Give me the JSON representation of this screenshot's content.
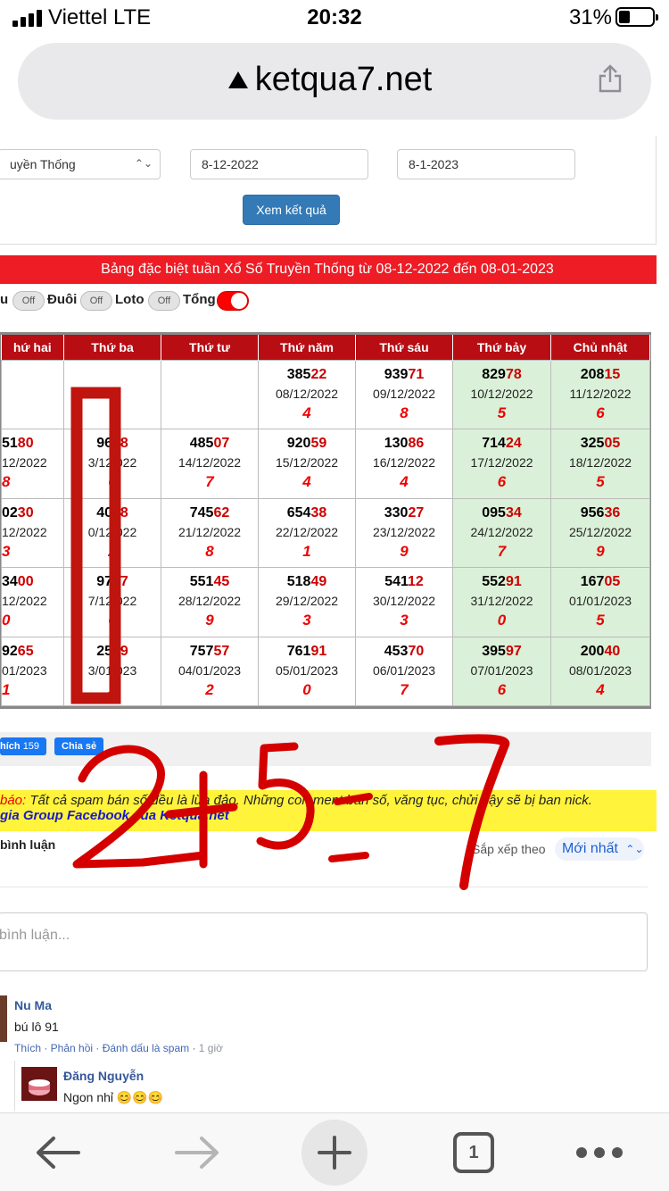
{
  "status_bar": {
    "carrier": "Viettel  LTE",
    "time": "20:32",
    "battery": "31%"
  },
  "browser": {
    "url": "ketqua7.net"
  },
  "form": {
    "type_value": "uyền Thống",
    "from_date": "8-12-2022",
    "to_date": "8-1-2023",
    "submit_label": "Xem kết quả"
  },
  "banner": {
    "title": "Bảng đặc biệt tuần Xổ Số Truyền Thống từ 08-12-2022 đến 08-01-2023"
  },
  "toggles": [
    {
      "label": "u",
      "state": "Off"
    },
    {
      "label": "Đuôi",
      "state": "Off"
    },
    {
      "label": "Loto",
      "state": "Off"
    },
    {
      "label": "Tổng",
      "state": ""
    }
  ],
  "table": {
    "headers": [
      "hứ hai",
      "Thứ ba",
      "Thứ tư",
      "Thứ năm",
      "Thứ sáu",
      "Thứ bảy",
      "Chủ nhật"
    ],
    "rows": [
      [
        {
          "head": "",
          "tail": "",
          "date": "",
          "sum": ""
        },
        {
          "head": "",
          "tail": "",
          "date": "",
          "sum": ""
        },
        {
          "head": "",
          "tail": "",
          "date": "",
          "sum": ""
        },
        {
          "head": "385",
          "tail": "22",
          "date": "08/12/2022",
          "sum": "4"
        },
        {
          "head": "939",
          "tail": "71",
          "date": "09/12/2022",
          "sum": "8"
        },
        {
          "head": "829",
          "tail": "78",
          "date": "10/12/2022",
          "sum": "5"
        },
        {
          "head": "208",
          "tail": "15",
          "date": "11/12/2022",
          "sum": "6"
        }
      ],
      [
        {
          "head": "51",
          "tail": "80",
          "date": "12/2022",
          "sum": "8"
        },
        {
          "head": "966",
          "tail": "8",
          "date": "3/12  022",
          "sum": "6"
        },
        {
          "head": "485",
          "tail": "07",
          "date": "14/12/2022",
          "sum": "7"
        },
        {
          "head": "920",
          "tail": "59",
          "date": "15/12/2022",
          "sum": "4"
        },
        {
          "head": "130",
          "tail": "86",
          "date": "16/12/2022",
          "sum": "4"
        },
        {
          "head": "714",
          "tail": "24",
          "date": "17/12/2022",
          "sum": "6"
        },
        {
          "head": "325",
          "tail": "05",
          "date": "18/12/2022",
          "sum": "5"
        }
      ],
      [
        {
          "head": "02",
          "tail": "30",
          "date": "12/2022",
          "sum": "3"
        },
        {
          "head": "404",
          "tail": "8",
          "date": "0/12  022",
          "sum": "2"
        },
        {
          "head": "745",
          "tail": "62",
          "date": "21/12/2022",
          "sum": "8"
        },
        {
          "head": "654",
          "tail": "38",
          "date": "22/12/2022",
          "sum": "1"
        },
        {
          "head": "330",
          "tail": "27",
          "date": "23/12/2022",
          "sum": "9"
        },
        {
          "head": "095",
          "tail": "34",
          "date": "24/12/2022",
          "sum": "7"
        },
        {
          "head": "956",
          "tail": "36",
          "date": "25/12/2022",
          "sum": "9"
        }
      ],
      [
        {
          "head": "34",
          "tail": "00",
          "date": "12/2022",
          "sum": "0"
        },
        {
          "head": "977",
          "tail": "7",
          "date": "7/12  022",
          "sum": "6"
        },
        {
          "head": "551",
          "tail": "45",
          "date": "28/12/2022",
          "sum": "9"
        },
        {
          "head": "518",
          "tail": "49",
          "date": "29/12/2022",
          "sum": "3"
        },
        {
          "head": "541",
          "tail": "12",
          "date": "30/12/2022",
          "sum": "3"
        },
        {
          "head": "552",
          "tail": "91",
          "date": "31/12/2022",
          "sum": "0"
        },
        {
          "head": "167",
          "tail": "05",
          "date": "01/01/2023",
          "sum": "5"
        }
      ],
      [
        {
          "head": "92",
          "tail": "65",
          "date": "01/2023",
          "sum": "1"
        },
        {
          "head": "256",
          "tail": "9",
          "date": "3/01  023",
          "sum": "3"
        },
        {
          "head": "757",
          "tail": "57",
          "date": "04/01/2023",
          "sum": "2"
        },
        {
          "head": "761",
          "tail": "91",
          "date": "05/01/2023",
          "sum": "0"
        },
        {
          "head": "453",
          "tail": "70",
          "date": "06/01/2023",
          "sum": "7"
        },
        {
          "head": "395",
          "tail": "97",
          "date": "07/01/2023",
          "sum": "6"
        },
        {
          "head": "200",
          "tail": "40",
          "date": "08/01/2023",
          "sum": "4"
        }
      ]
    ]
  },
  "social": {
    "like_label": "hích",
    "like_count": "159",
    "share_label": "Chia sẻ"
  },
  "notice": {
    "prefix": "báo:",
    "message": " Tất cả spam bán số đều là lừa đảo. Những comment bán số, văng tục, chửi bậy sẽ bị ban nick.",
    "group_link": "gia Group Facebook của Ketqua.net"
  },
  "comments": {
    "count_label": "bình luận",
    "sort_label": "Sắp xếp theo",
    "sort_value": "Mới nhất",
    "input_placeholder": "bình luận...",
    "items": [
      {
        "name": "Nu Ma",
        "text": "bú lô 91",
        "actions": "Thích · Phản hồi · Đánh dấu là spam · ",
        "time": "1 giờ"
      },
      {
        "name": "Đăng Nguyễn",
        "text": "Ngon nhỉ 😊😊😊"
      }
    ]
  },
  "annotation": {
    "handwriting": "2+5=7"
  },
  "toolbar": {
    "tabs_count": "1"
  },
  "colors": {
    "banner": "#ee1c25",
    "header": "#b70d13",
    "weekend": "#daf0d8",
    "ink": "#d40000"
  }
}
